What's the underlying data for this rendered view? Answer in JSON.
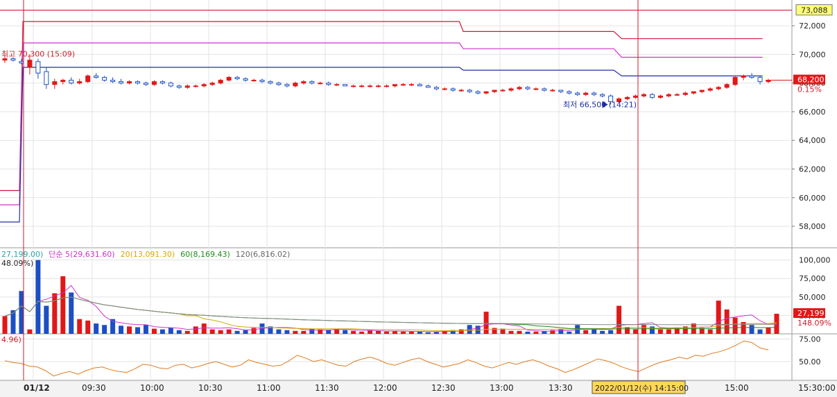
{
  "chart_data": {
    "type": "candlestick",
    "price_panel": {
      "y_ticks": [
        "72,000",
        "70,000",
        "68,000",
        "66,000",
        "64,000",
        "62,000",
        "60,000",
        "58,000"
      ],
      "ylim": [
        56500,
        73800
      ],
      "current_price_label": "68,200",
      "current_change_label": "0.15%",
      "top_ref_label": "73,088",
      "high_annotation": "최고 70,300 (15:09)",
      "low_annotation": "최저 66,500 (14:21)",
      "reference_lines": [
        {
          "name": "top",
          "color": "#d2143a",
          "points": [
            [
              0,
              73088
            ],
            [
              1,
              73088
            ]
          ]
        },
        {
          "name": "upper-1",
          "color": "#d2143a",
          "points": [
            [
              0,
              60500
            ],
            [
              0.0245,
              60500
            ],
            [
              0.029,
              72300
            ],
            [
              0.58,
              72300
            ],
            [
              0.585,
              71600
            ],
            [
              0.775,
              71600
            ],
            [
              0.785,
              71100
            ],
            [
              0.963,
              71100
            ]
          ]
        },
        {
          "name": "upper-2",
          "color": "#cc33cc",
          "points": [
            [
              0,
              59500
            ],
            [
              0.0245,
              59500
            ],
            [
              0.029,
              70800
            ],
            [
              0.58,
              70800
            ],
            [
              0.585,
              70400
            ],
            [
              0.775,
              70400
            ],
            [
              0.785,
              69800
            ],
            [
              0.963,
              69800
            ]
          ]
        },
        {
          "name": "upper-3",
          "color": "#1f2fa8",
          "points": [
            [
              0,
              58300
            ],
            [
              0.0245,
              58300
            ],
            [
              0.029,
              69100
            ],
            [
              0.58,
              69100
            ],
            [
              0.585,
              68900
            ],
            [
              0.775,
              68900
            ],
            [
              0.785,
              68500
            ],
            [
              0.963,
              68500
            ]
          ]
        }
      ],
      "candles": [
        [
          69600,
          69900,
          69400,
          69700
        ],
        [
          69700,
          69800,
          69500,
          69600
        ],
        [
          69500,
          69700,
          69300,
          69400
        ],
        [
          69100,
          70000,
          68600,
          69600
        ],
        [
          69500,
          69700,
          68300,
          68700
        ],
        [
          68800,
          69100,
          67600,
          67900
        ],
        [
          67900,
          68300,
          67600,
          68100
        ],
        [
          68100,
          68300,
          67900,
          68200
        ],
        [
          68200,
          68400,
          67900,
          68000
        ],
        [
          68000,
          68300,
          67900,
          68100
        ],
        [
          68100,
          68600,
          68000,
          68500
        ],
        [
          68500,
          68700,
          68300,
          68400
        ],
        [
          68400,
          68500,
          68100,
          68200
        ],
        [
          68200,
          68400,
          68000,
          68100
        ],
        [
          68100,
          68300,
          67900,
          68000
        ],
        [
          68000,
          68200,
          67900,
          68100
        ],
        [
          68100,
          68200,
          67900,
          68000
        ],
        [
          68000,
          68100,
          67800,
          67900
        ],
        [
          67900,
          68200,
          67800,
          68100
        ],
        [
          68100,
          68200,
          67900,
          68000
        ],
        [
          68000,
          68100,
          67700,
          67800
        ],
        [
          67800,
          67900,
          67600,
          67700
        ],
        [
          67700,
          67900,
          67600,
          67800
        ],
        [
          67800,
          67900,
          67700,
          67800
        ],
        [
          67800,
          68000,
          67700,
          67900
        ],
        [
          67900,
          68100,
          67800,
          68000
        ],
        [
          68000,
          68300,
          67900,
          68200
        ],
        [
          68200,
          68500,
          68100,
          68400
        ],
        [
          68400,
          68500,
          68200,
          68300
        ],
        [
          68300,
          68400,
          68100,
          68200
        ],
        [
          68200,
          68300,
          68100,
          68200
        ],
        [
          68200,
          68300,
          68000,
          68100
        ],
        [
          68100,
          68200,
          67900,
          68000
        ],
        [
          68000,
          68100,
          67800,
          67900
        ],
        [
          67900,
          68000,
          67700,
          67800
        ],
        [
          67800,
          68100,
          67700,
          68000
        ],
        [
          68000,
          68200,
          67900,
          68100
        ],
        [
          68100,
          68200,
          67900,
          68000
        ],
        [
          68000,
          68100,
          67900,
          68000
        ],
        [
          68000,
          68100,
          67800,
          67900
        ],
        [
          67900,
          68000,
          67800,
          67900
        ],
        [
          67900,
          67900,
          67800,
          67800
        ],
        [
          67800,
          67900,
          67700,
          67800
        ],
        [
          67800,
          67900,
          67700,
          67800
        ],
        [
          67800,
          67900,
          67700,
          67800
        ],
        [
          67800,
          67900,
          67700,
          67800
        ],
        [
          67800,
          67900,
          67700,
          67800
        ],
        [
          67800,
          67900,
          67700,
          67900
        ],
        [
          67900,
          68000,
          67800,
          67900
        ],
        [
          67900,
          68000,
          67800,
          67900
        ],
        [
          67900,
          68000,
          67800,
          67800
        ],
        [
          67800,
          67900,
          67700,
          67700
        ],
        [
          67700,
          67800,
          67500,
          67600
        ],
        [
          67600,
          67700,
          67500,
          67600
        ],
        [
          67600,
          67700,
          67400,
          67500
        ],
        [
          67500,
          67600,
          67400,
          67500
        ],
        [
          67500,
          67600,
          67300,
          67400
        ],
        [
          67400,
          67500,
          67200,
          67300
        ],
        [
          67300,
          67400,
          67200,
          67400
        ],
        [
          67400,
          67500,
          67300,
          67500
        ],
        [
          67500,
          67600,
          67400,
          67500
        ],
        [
          67500,
          67700,
          67400,
          67600
        ],
        [
          67600,
          67800,
          67500,
          67700
        ],
        [
          67700,
          67800,
          67500,
          67600
        ],
        [
          67600,
          67700,
          67500,
          67600
        ],
        [
          67600,
          67700,
          67400,
          67500
        ],
        [
          67500,
          67600,
          67400,
          67500
        ],
        [
          67500,
          67500,
          67300,
          67400
        ],
        [
          67400,
          67500,
          67200,
          67300
        ],
        [
          67300,
          67400,
          67100,
          67200
        ],
        [
          67200,
          67400,
          67100,
          67300
        ],
        [
          67300,
          67400,
          67100,
          67200
        ],
        [
          67200,
          67300,
          67000,
          67100
        ],
        [
          67100,
          67200,
          66500,
          66700
        ],
        [
          66700,
          67000,
          66600,
          66900
        ],
        [
          66900,
          67100,
          66800,
          67000
        ],
        [
          67000,
          67200,
          66900,
          67100
        ],
        [
          67100,
          67300,
          67000,
          67200
        ],
        [
          67200,
          67300,
          66900,
          67000
        ],
        [
          67000,
          67200,
          66900,
          67100
        ],
        [
          67100,
          67300,
          67000,
          67200
        ],
        [
          67200,
          67300,
          67100,
          67200
        ],
        [
          67200,
          67400,
          67100,
          67300
        ],
        [
          67300,
          67400,
          67200,
          67400
        ],
        [
          67400,
          67500,
          67300,
          67500
        ],
        [
          67500,
          67700,
          67400,
          67600
        ],
        [
          67600,
          67800,
          67500,
          67700
        ],
        [
          67700,
          68000,
          67600,
          67900
        ],
        [
          67900,
          68500,
          67800,
          68400
        ],
        [
          68400,
          68600,
          68200,
          68500
        ],
        [
          68500,
          68700,
          68300,
          68400
        ],
        [
          68400,
          68500,
          67900,
          68100
        ],
        [
          68100,
          68300,
          68000,
          68200
        ]
      ]
    },
    "volume_panel": {
      "legend": [
        {
          "text": "27,199.00)",
          "color": "#2aa5a5"
        },
        {
          "text": "단순 5(29,631.60)",
          "color": "#cc33cc"
        },
        {
          "text": "20(13,091.30)",
          "color": "#d8a800"
        },
        {
          "text": "60(8,169.43)",
          "color": "#1c8c1c"
        },
        {
          "text": "120(6,816.02)",
          "color": "#666666"
        }
      ],
      "sub_legend": "48.09%)",
      "y_ticks": [
        "100,000",
        "75,000",
        "50,000",
        "25,000"
      ],
      "ylim": [
        0,
        110000
      ],
      "current_volume_label": "27,199",
      "current_ratio_label": "148.09%",
      "volumes": [
        24000,
        32000,
        58000,
        6000,
        100000,
        38000,
        55000,
        78000,
        56000,
        20000,
        18000,
        14000,
        12000,
        20000,
        11000,
        10000,
        9000,
        12000,
        7000,
        6000,
        8000,
        5000,
        4000,
        10000,
        14000,
        6000,
        5000,
        6000,
        4000,
        5000,
        8000,
        14000,
        10000,
        6000,
        5000,
        4000,
        4000,
        7000,
        6000,
        5000,
        7000,
        5000,
        4000,
        3000,
        5000,
        4000,
        3000,
        4000,
        3000,
        3000,
        3000,
        2000,
        3000,
        4000,
        5000,
        6000,
        12000,
        11000,
        30000,
        8000,
        7000,
        4000,
        4000,
        3000,
        3000,
        4000,
        5000,
        6000,
        3000,
        12000,
        5000,
        6000,
        4000,
        5000,
        38000,
        9000,
        6000,
        12000,
        10000,
        6000,
        6000,
        8000,
        10000,
        14000,
        8000,
        6000,
        45000,
        33000,
        22000,
        16000,
        12000,
        6000,
        8000,
        27199
      ]
    },
    "indicator_panel": {
      "legend": "4.96)",
      "y_ticks": [
        "75.00",
        "50.00"
      ],
      "ylim": [
        30,
        80
      ],
      "values": [
        51,
        49,
        48,
        45,
        44,
        40,
        34,
        37,
        39,
        36,
        40,
        43,
        44,
        41,
        39,
        38,
        42,
        47,
        46,
        43,
        42,
        46,
        47,
        43,
        45,
        48,
        50,
        47,
        44,
        46,
        52,
        49,
        47,
        45,
        46,
        51,
        57,
        54,
        50,
        52,
        49,
        46,
        45,
        50,
        53,
        55,
        52,
        48,
        46,
        49,
        52,
        54,
        50,
        47,
        44,
        46,
        48,
        52,
        49,
        45,
        43,
        46,
        49,
        47,
        50,
        52,
        49,
        45,
        42,
        38,
        41,
        45,
        49,
        53,
        51,
        48,
        44,
        41,
        39,
        43,
        47,
        50,
        52,
        55,
        53,
        57,
        56,
        59,
        61,
        64,
        68,
        73,
        71,
        65,
        63
      ]
    },
    "x_axis": {
      "labels": [
        "01/12",
        "09:30",
        "10:00",
        "10:30",
        "11:00",
        "11:30",
        "12:00",
        "12:30",
        "13:00",
        "13:30",
        "15:00"
      ],
      "end_label": "15:30:00",
      "crosshair_label": "2022/01/12(수) 14:15:00"
    }
  },
  "colors": {
    "up": "#e01818",
    "down": "#1c4fc4",
    "grid": "#e3e3e3",
    "crosshair": "#d21a2a",
    "axis_text": "#222222",
    "indicator_line": "#e07a1c"
  }
}
